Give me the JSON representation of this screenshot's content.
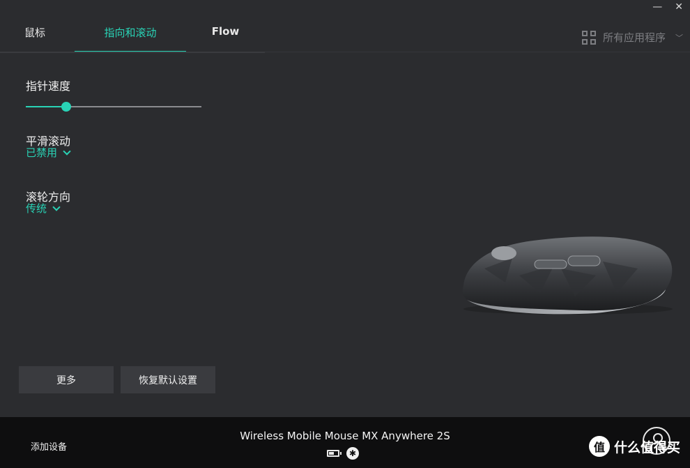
{
  "window": {
    "minimize_glyph": "—",
    "close_glyph": "✕"
  },
  "tabs": [
    {
      "label": "鼠标",
      "active": false
    },
    {
      "label": "指向和滚动",
      "active": true
    },
    {
      "label": "Flow",
      "active": false
    }
  ],
  "app_picker": {
    "label": "所有应用程序",
    "icon": "grid-icon",
    "chevron": "﹀"
  },
  "settings": {
    "pointer_speed": {
      "title": "指针速度",
      "value_fraction": 0.23
    },
    "smooth_scrolling": {
      "title": "平滑滚动",
      "value": "已禁用"
    },
    "scroll_direction": {
      "title": "滚轮方向",
      "value": "传统"
    }
  },
  "buttons": {
    "more": "更多",
    "reset": "恢复默认设置"
  },
  "footer": {
    "add_device": "添加设备",
    "device_name": "Wireless Mobile Mouse MX Anywhere 2S",
    "battery_fraction": 0.6,
    "bluetooth_glyph": "✱"
  },
  "watermark": {
    "badge": "值",
    "text": "什么值得买"
  },
  "colors": {
    "accent": "#29d3b6",
    "background": "#2b2c2f",
    "footer": "#0e0e0f"
  }
}
